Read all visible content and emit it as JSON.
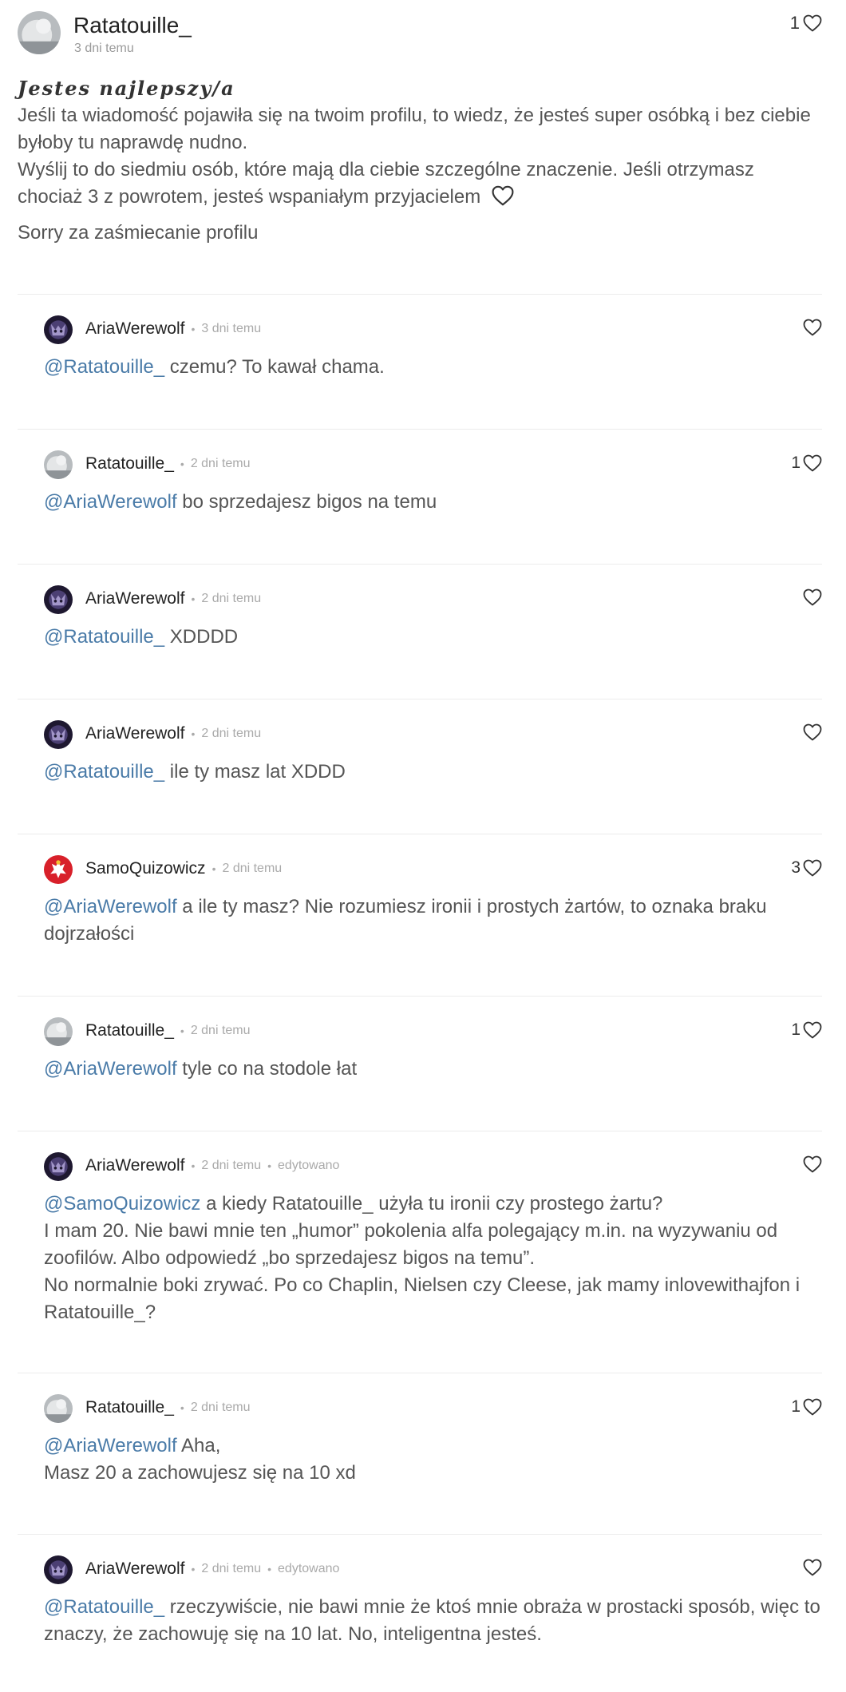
{
  "post": {
    "author": "Ratatouille_",
    "time": "3 dni temu",
    "likes": "1",
    "title": "Jestes najlepszy/a",
    "lines": [
      "Jeśli ta wiadomość pojawiła się na twoim profilu, to wiedz, że jesteś super osóbką i bez ciebie byłoby tu naprawdę nudno.",
      "Wyślij to do siedmiu osób, które mają dla ciebie szczególne znaczenie. Jeśli otrzymasz chociaż 3 z powrotem, jesteś wspaniałym przyjacielem"
    ],
    "footer": "Sorry za zaśmiecanie profilu"
  },
  "comments": [
    {
      "author": "AriaWerewolf",
      "time": "3 dni temu",
      "likes": "",
      "mention": "@Ratatouille_",
      "text": " czemu? To kawał chama."
    },
    {
      "author": "Ratatouille_",
      "time": "2 dni temu",
      "likes": "1",
      "mention": "@AriaWerewolf",
      "text": " bo sprzedajesz bigos na temu"
    },
    {
      "author": "AriaWerewolf",
      "time": "2 dni temu",
      "likes": "",
      "mention": "@Ratatouille_",
      "text": " XDDDD"
    },
    {
      "author": "AriaWerewolf",
      "time": "2 dni temu",
      "likes": "",
      "mention": "@Ratatouille_",
      "text": " ile ty masz lat XDDD"
    },
    {
      "author": "SamoQuizowicz",
      "time": "2 dni temu",
      "likes": "3",
      "mention": "@AriaWerewolf",
      "text": " a ile ty masz? Nie rozumiesz ironii i prostych żartów, to oznaka braku dojrzałości"
    },
    {
      "author": "Ratatouille_",
      "time": "2 dni temu",
      "likes": "1",
      "mention": "@AriaWerewolf",
      "text": " tyle co na stodole łat"
    },
    {
      "author": "AriaWerewolf",
      "time": "2 dni temu",
      "edited": "edytowano",
      "likes": "",
      "mention": "@SamoQuizowicz",
      "text": " a kiedy Ratatouille_ użyła tu ironii czy prostego żartu?",
      "extra": [
        "I mam 20. Nie bawi mnie ten „humor” pokolenia alfa polegający m.in. na wyzywaniu od zoofilów. Albo odpowiedź „bo sprzedajesz bigos na temu”.",
        "No normalnie boki zrywać. Po co Chaplin, Nielsen czy Cleese, jak mamy inlovewithajfon i Ratatouille_?"
      ]
    },
    {
      "author": "Ratatouille_",
      "time": "2 dni temu",
      "likes": "1",
      "mention": "@AriaWerewolf",
      "text": " Aha,",
      "extra": [
        "Masz 20 a zachowujesz się na 10 xd"
      ]
    },
    {
      "author": "AriaWerewolf",
      "time": "2 dni temu",
      "edited": "edytowano",
      "likes": "",
      "mention": "@Ratatouille_",
      "text": " rzeczywiście, nie bawi mnie że ktoś mnie obraża w prostacki sposób, więc to znaczy, że zachowuję się na 10 lat. No, inteligentna jesteś."
    }
  ],
  "icons": {
    "like": "heart-icon",
    "avatar_aria": "wolf-avatar",
    "avatar_rat": "rat-avatar",
    "avatar_samo": "polish-eagle-avatar"
  },
  "colors": {
    "mention": "#4a7ba8",
    "meta": "#aaaaaa",
    "divider": "#ececec"
  }
}
